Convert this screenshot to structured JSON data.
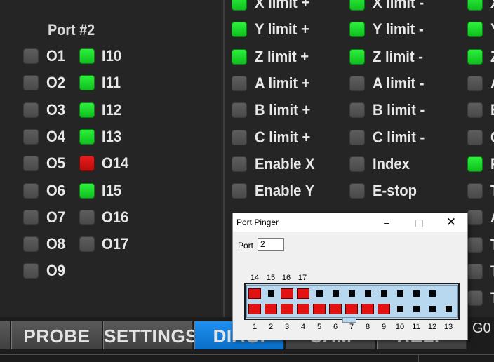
{
  "port2": {
    "title": "Port #2",
    "rows": [
      {
        "left": {
          "label": "O1",
          "state": "off"
        },
        "right": {
          "label": "I10",
          "state": "green"
        }
      },
      {
        "left": {
          "label": "O2",
          "state": "off"
        },
        "right": {
          "label": "I11",
          "state": "green"
        }
      },
      {
        "left": {
          "label": "O3",
          "state": "off"
        },
        "right": {
          "label": "I12",
          "state": "green"
        }
      },
      {
        "left": {
          "label": "O4",
          "state": "off"
        },
        "right": {
          "label": "I13",
          "state": "green"
        }
      },
      {
        "left": {
          "label": "O5",
          "state": "off"
        },
        "right": {
          "label": "O14",
          "state": "red"
        }
      },
      {
        "left": {
          "label": "O6",
          "state": "off"
        },
        "right": {
          "label": "I15",
          "state": "green"
        }
      },
      {
        "left": {
          "label": "O7",
          "state": "off"
        },
        "right": {
          "label": "O16",
          "state": "off"
        }
      },
      {
        "left": {
          "label": "O8",
          "state": "off"
        },
        "right": {
          "label": "O17",
          "state": "off"
        }
      },
      {
        "left": {
          "label": "O9",
          "state": "off"
        },
        "right": null
      }
    ]
  },
  "signals": {
    "col1": [
      {
        "label": "X limit +",
        "state": "green"
      },
      {
        "label": "Y limit +",
        "state": "green"
      },
      {
        "label": "Z limit +",
        "state": "green"
      },
      {
        "label": "A limit +",
        "state": "off"
      },
      {
        "label": "B limit +",
        "state": "off"
      },
      {
        "label": "C limit +",
        "state": "off"
      },
      {
        "label": "Enable X",
        "state": "off"
      },
      {
        "label": "Enable Y",
        "state": "off"
      }
    ],
    "col2": [
      {
        "label": "X limit -",
        "state": "green"
      },
      {
        "label": "Y limit -",
        "state": "green"
      },
      {
        "label": "Z limit -",
        "state": "green"
      },
      {
        "label": "A limit -",
        "state": "off"
      },
      {
        "label": "B limit -",
        "state": "off"
      },
      {
        "label": "C limit -",
        "state": "off"
      },
      {
        "label": "Index",
        "state": "off"
      },
      {
        "label": "E-stop",
        "state": "off"
      }
    ],
    "col3": [
      {
        "label": "X",
        "state": "green"
      },
      {
        "label": "Y",
        "state": "green"
      },
      {
        "label": "Z",
        "state": "green"
      },
      {
        "label": "A",
        "state": "off"
      },
      {
        "label": "B",
        "state": "off"
      },
      {
        "label": "C",
        "state": "off"
      },
      {
        "label": "F",
        "state": "green"
      },
      {
        "label": "T",
        "state": "off"
      },
      {
        "label": "A",
        "state": "off"
      },
      {
        "label": "T",
        "state": "off"
      },
      {
        "label": "T",
        "state": "off"
      },
      {
        "label": "T",
        "state": "off"
      }
    ]
  },
  "tabs": [
    {
      "label": "PROBE",
      "active": false
    },
    {
      "label": "SETTINGS",
      "active": false
    },
    {
      "label": "DIAG.",
      "active": true
    },
    {
      "label": "CAM",
      "active": false
    },
    {
      "label": "HELP",
      "active": false
    }
  ],
  "status_right": "G0",
  "dialog": {
    "title": "Port Pinger",
    "port_label": "Port",
    "port_value": "2",
    "minimize_icon": "minimize-icon",
    "maximize_icon": "maximize-icon",
    "close_icon": "close-icon",
    "top_labels": [
      "14",
      "15",
      "16",
      "17"
    ],
    "bottom_labels": [
      "1",
      "2",
      "3",
      "4",
      "5",
      "6",
      "7",
      "8",
      "9",
      "10",
      "11",
      "12",
      "13"
    ],
    "top_pins": [
      "red",
      "dot",
      "red",
      "red",
      "dot",
      "dot",
      "dot",
      "dot",
      "dot",
      "dot",
      "dot",
      "dot"
    ],
    "bottom_pins": [
      "red",
      "red",
      "red",
      "red",
      "red",
      "red",
      "red",
      "red",
      "red",
      "dot",
      "dot",
      "dot",
      "dot"
    ],
    "colors": {
      "connector": "#b8d8f0",
      "pin_on": "#e3110f"
    }
  }
}
